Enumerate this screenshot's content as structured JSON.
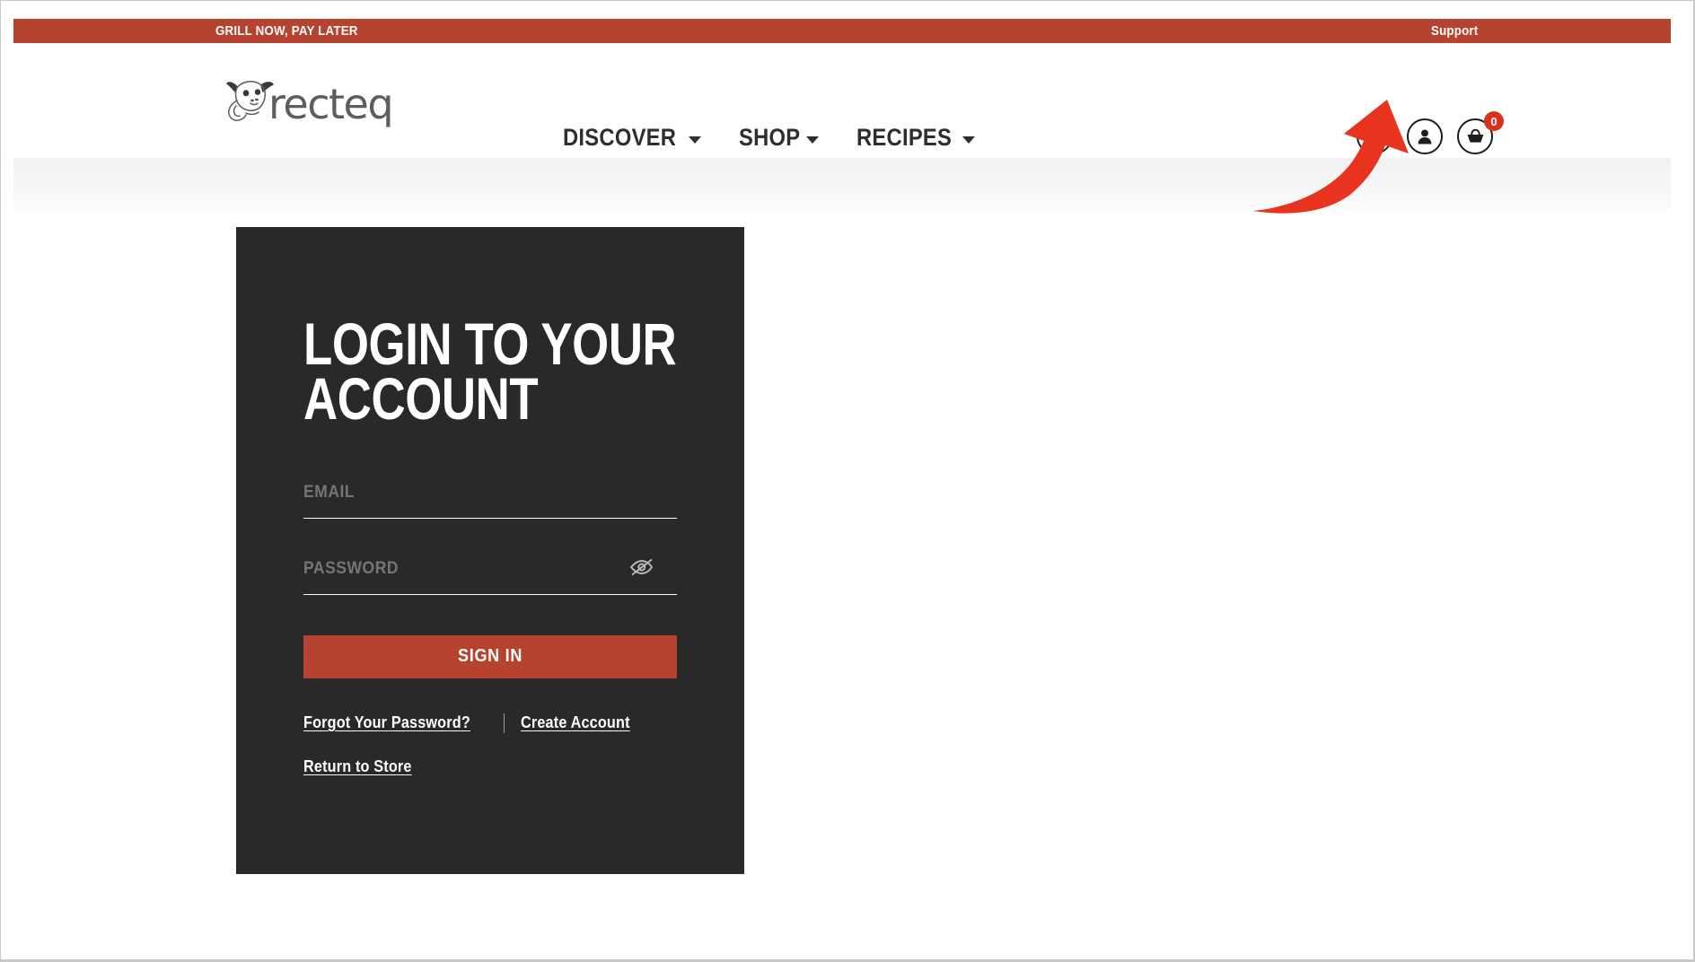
{
  "announcement": {
    "promo_text": "GRILL NOW, PAY LATER",
    "support_label": "Support"
  },
  "header": {
    "brand_name": "recteq",
    "logo_icon": "bull-head-icon",
    "nav": [
      {
        "label": "DISCOVER",
        "caret_icon": "chevron-down-icon"
      },
      {
        "label": "SHOP",
        "caret_icon": "chevron-down-icon"
      },
      {
        "label": "RECIPES",
        "caret_icon": "chevron-down-icon"
      }
    ],
    "actions": {
      "search_icon": "search-icon",
      "account_icon": "user-account-icon",
      "cart_icon": "shopping-basket-icon",
      "cart_count": "0"
    }
  },
  "login": {
    "title": "LOGIN TO YOUR ACCOUNT",
    "email_label": "EMAIL",
    "email_value": "",
    "password_label": "PASSWORD",
    "password_value": "",
    "password_toggle_icon": "eye-slash-icon",
    "submit_label": "SIGN IN",
    "forgot_password_link": "Forgot Your Password?",
    "create_account_link": "Create Account",
    "return_to_store_link": "Return to Store"
  },
  "annotation": {
    "arrow_icon": "curved-arrow-up-right-icon",
    "arrow_color": "#E8331F",
    "points_at": "user-account-icon"
  },
  "colors": {
    "brand_red": "#B5432F",
    "badge_red": "#D8321F",
    "card_dark": "#292929",
    "page_white": "#FFFFFF",
    "breadcrumb_gray": "#F3F3F3"
  }
}
